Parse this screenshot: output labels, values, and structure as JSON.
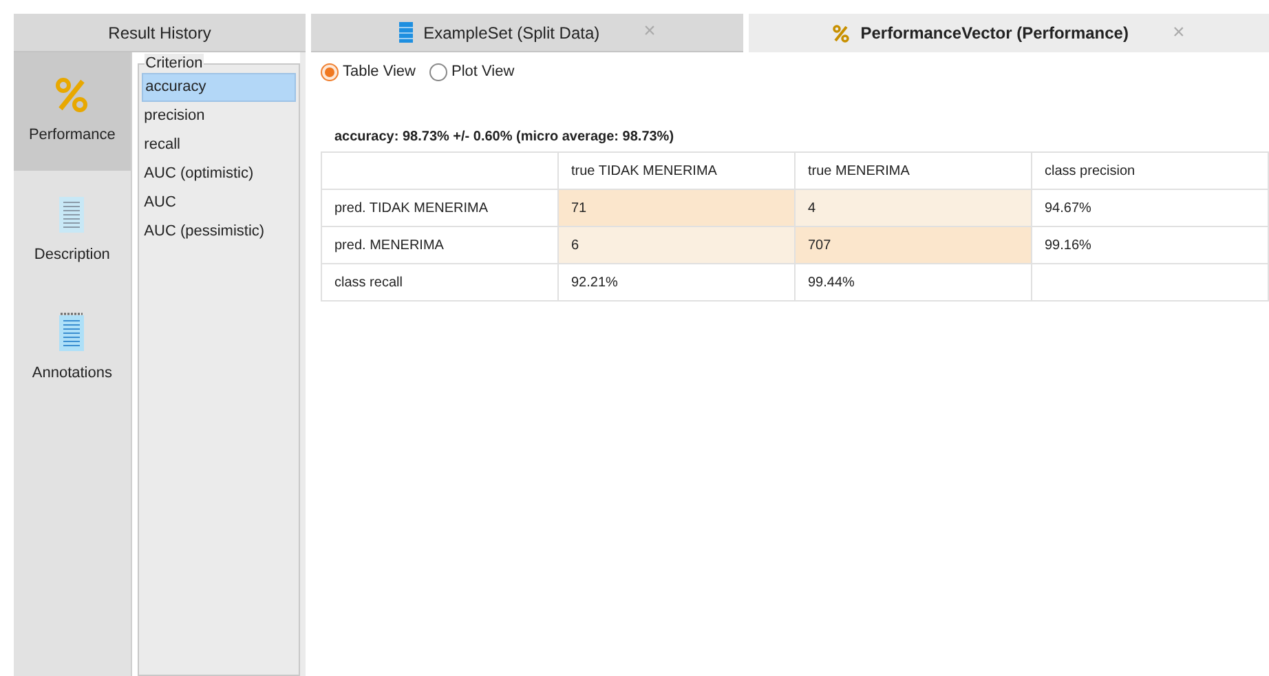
{
  "tabs": [
    {
      "label": "Result History",
      "selected": false,
      "kind": "plain"
    },
    {
      "label": "ExampleSet (Split Data)",
      "selected": false,
      "kind": "data",
      "close": "×"
    },
    {
      "label": "PerformanceVector (Performance)",
      "selected": true,
      "kind": "performance",
      "close": "×"
    }
  ],
  "sidebar": {
    "items": [
      {
        "label": "Performance",
        "selected": true,
        "kind": "percent"
      },
      {
        "label": "Description",
        "selected": false,
        "kind": "document"
      },
      {
        "label": "Annotations",
        "selected": false,
        "kind": "notes"
      }
    ]
  },
  "criterion": {
    "title": "Criterion",
    "items": [
      {
        "label": "accuracy",
        "selected": true
      },
      {
        "label": "precision",
        "selected": false
      },
      {
        "label": "recall",
        "selected": false
      },
      {
        "label": "AUC (optimistic)",
        "selected": false
      },
      {
        "label": "AUC",
        "selected": false
      },
      {
        "label": "AUC (pessimistic)",
        "selected": false
      }
    ]
  },
  "views": [
    {
      "label": "Table View",
      "selected": true
    },
    {
      "label": "Plot View",
      "selected": false
    }
  ],
  "summary": "accuracy: 98.73% +/- 0.60% (micro average: 98.73%)",
  "table": {
    "columns": [
      "",
      "true TIDAK MENERIMA",
      "true MENERIMA",
      "class precision"
    ],
    "rows": [
      {
        "cells": [
          {
            "text": "pred. TIDAK MENERIMA",
            "kind": "label"
          },
          {
            "text": "71",
            "kind": "hit"
          },
          {
            "text": "4",
            "kind": "miss"
          },
          {
            "text": "94.67%",
            "kind": "plain"
          }
        ]
      },
      {
        "cells": [
          {
            "text": "pred. MENERIMA",
            "kind": "label"
          },
          {
            "text": "6",
            "kind": "miss"
          },
          {
            "text": "707",
            "kind": "hit"
          },
          {
            "text": "99.16%",
            "kind": "plain"
          }
        ]
      },
      {
        "cells": [
          {
            "text": "class recall",
            "kind": "label"
          },
          {
            "text": "92.21%",
            "kind": "plain"
          },
          {
            "text": "99.44%",
            "kind": "plain"
          },
          {
            "text": "",
            "kind": "plain"
          }
        ]
      }
    ]
  }
}
